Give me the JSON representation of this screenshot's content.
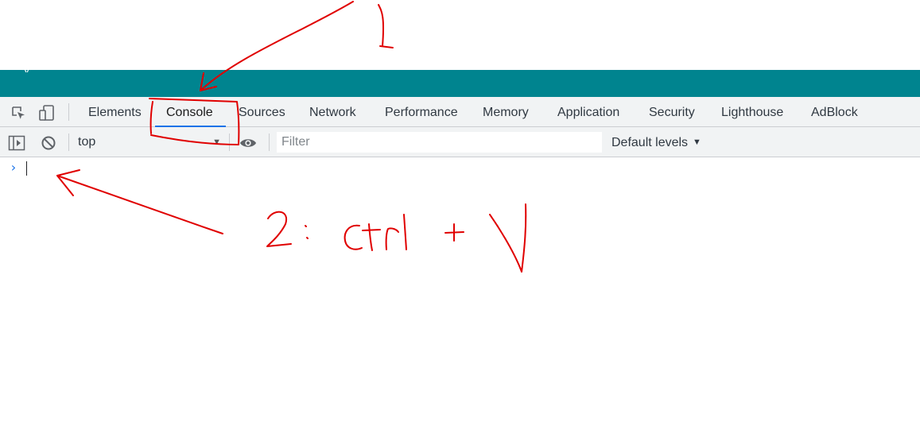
{
  "tabs": {
    "elements": "Elements",
    "console": "Console",
    "sources": "Sources",
    "network": "Network",
    "performance": "Performance",
    "memory": "Memory",
    "application": "Application",
    "security": "Security",
    "lighthouse": "Lighthouse",
    "adblock": "AdBlock"
  },
  "console_toolbar": {
    "context": "top",
    "filter_placeholder": "Filter",
    "levels": "Default levels"
  },
  "prompt": {
    "symbol": "›"
  },
  "annotations": {
    "step1": "1",
    "step2": "2: Ctrl + V"
  },
  "colors": {
    "teal_band": "#00848f",
    "active_tab_underline": "#1a73e8",
    "annotation_ink": "#e00000"
  },
  "icons": [
    "inspect-element-icon",
    "device-toolbar-icon",
    "sidebar-toggle-icon",
    "clear-console-icon",
    "eye-icon",
    "dropdown-arrow-icon"
  ]
}
